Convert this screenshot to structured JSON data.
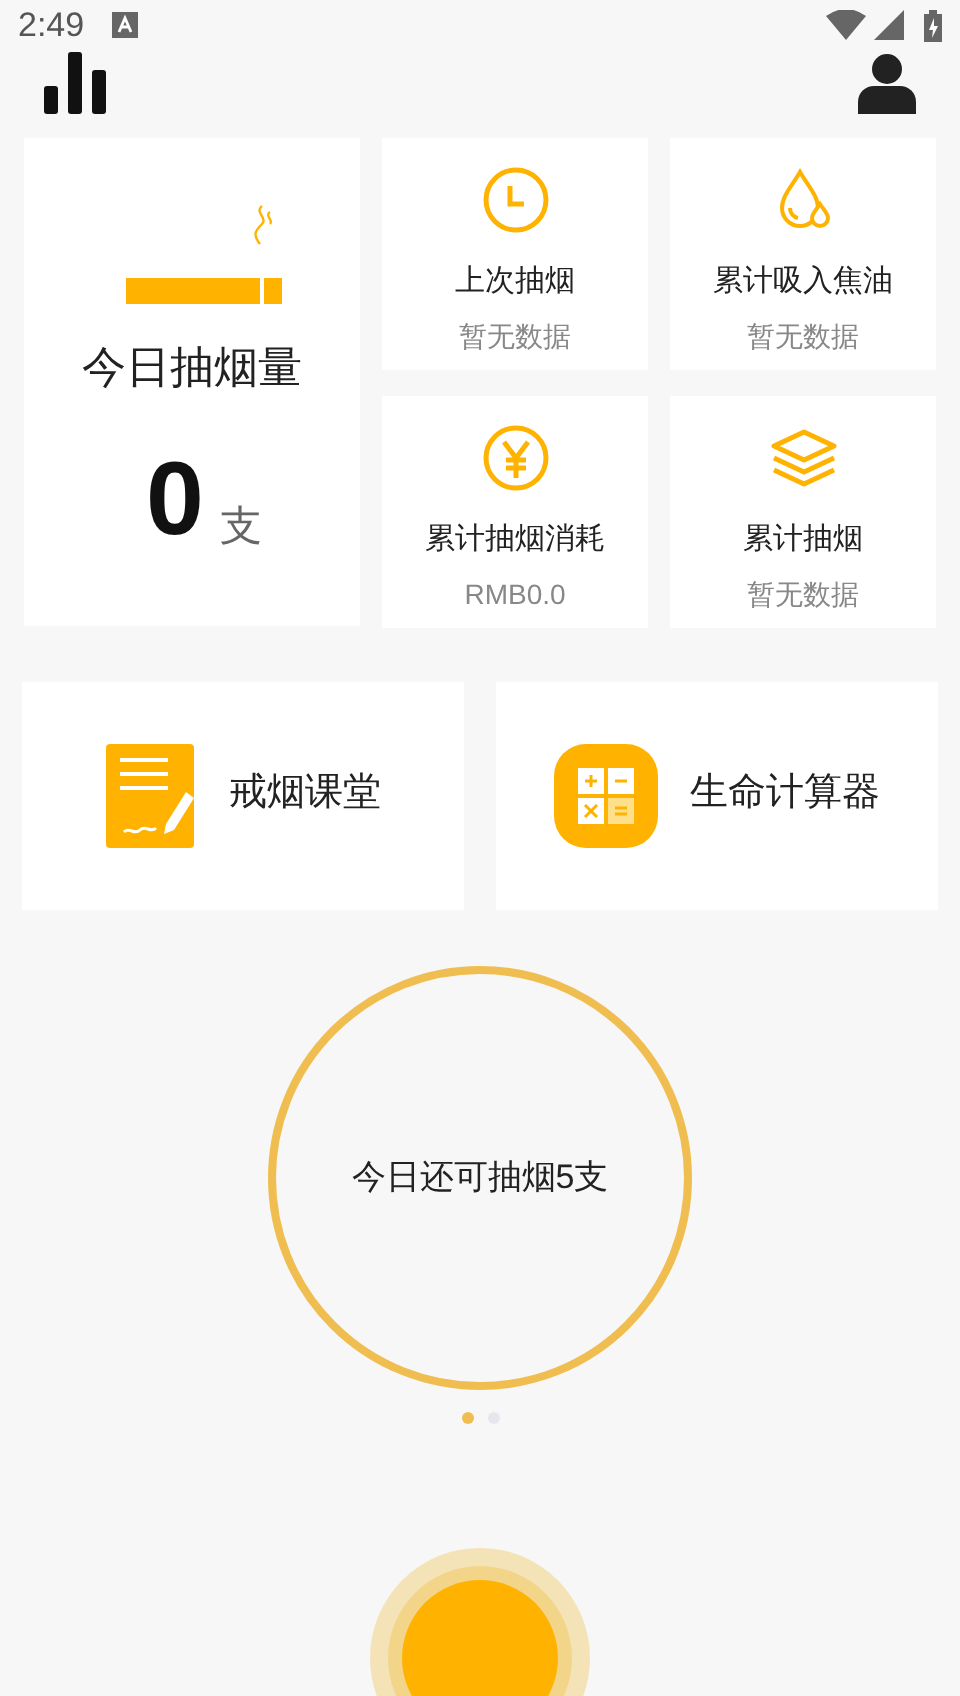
{
  "status_bar": {
    "time": "2:49"
  },
  "today_card": {
    "title": "今日抽烟量",
    "count": "0",
    "unit": "支"
  },
  "stats": [
    {
      "kind": "clock",
      "title": "上次抽烟",
      "value": "暂无数据"
    },
    {
      "kind": "drop",
      "title": "累计吸入焦油",
      "value": "暂无数据"
    },
    {
      "kind": "yen",
      "title": "累计抽烟消耗",
      "value": "RMB0.0"
    },
    {
      "kind": "layers",
      "title": "累计抽烟",
      "value": "暂无数据"
    }
  ],
  "tools": [
    {
      "kind": "note",
      "label": "戒烟课堂"
    },
    {
      "kind": "calculator",
      "label": "生命计算器"
    }
  ],
  "ring": {
    "text": "今日还可抽烟5支"
  },
  "pager": [
    {
      "selected": true
    },
    {
      "selected": false
    }
  ]
}
